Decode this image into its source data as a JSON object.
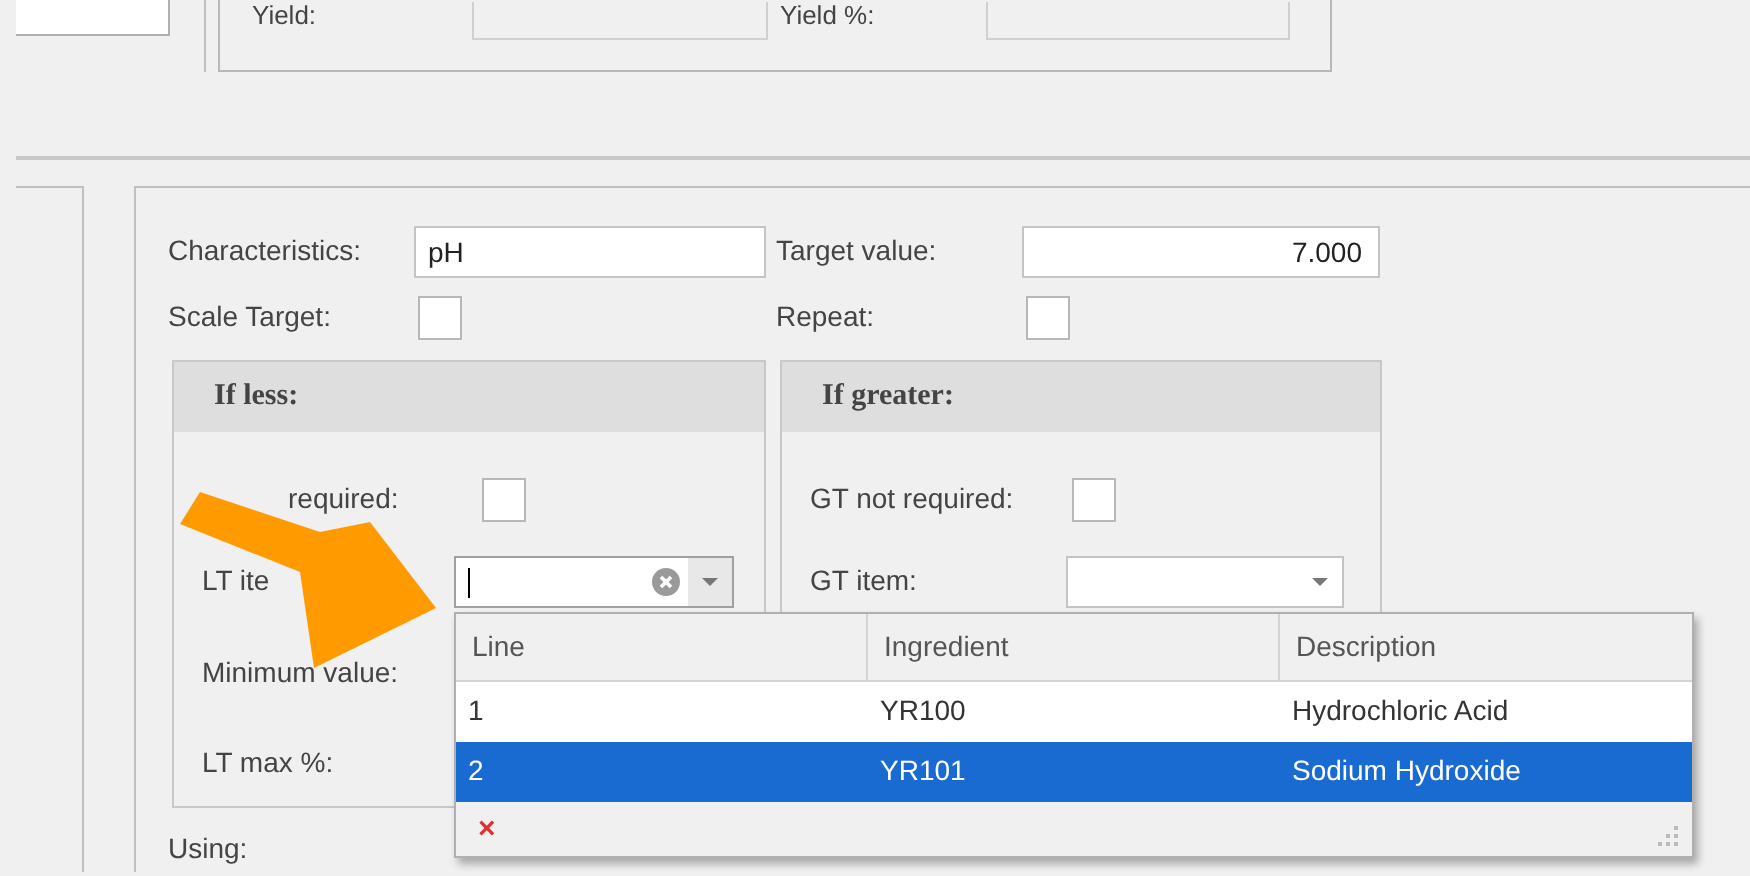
{
  "top_fields": [
    {
      "label": "Yield:"
    },
    {
      "label": "Yield %:"
    }
  ],
  "characteristics": {
    "label": "Characteristics:",
    "value": "pH"
  },
  "target_value": {
    "label": "Target value:",
    "value": "7.000"
  },
  "scale_target": {
    "label": "Scale Target:",
    "checked": false
  },
  "repeat": {
    "label": "Repeat:",
    "checked": false
  },
  "groups": [
    {
      "title": "If less:",
      "rows": [
        {
          "kind": "checkbox",
          "label": "required:",
          "checked": false
        },
        {
          "kind": "combo",
          "label": "LT ite",
          "focused": true,
          "clearable": true
        },
        {
          "kind": "text",
          "label": "Minimum value:"
        },
        {
          "kind": "text",
          "label": "LT max %:"
        }
      ]
    },
    {
      "title": "If greater:",
      "rows": [
        {
          "kind": "checkbox",
          "label": "GT not required:",
          "checked": false
        },
        {
          "kind": "combo",
          "label": "GT item:",
          "focused": false,
          "clearable": false
        }
      ]
    }
  ],
  "using": {
    "label": "Using:"
  },
  "dropdown": {
    "columns": [
      "Line",
      "Ingredient",
      "Description"
    ],
    "rows": [
      {
        "cells": [
          "1",
          "YR100",
          "Hydrochloric Acid"
        ],
        "selected": false
      },
      {
        "cells": [
          "2",
          "YR101",
          "Sodium Hydroxide"
        ],
        "selected": true
      }
    ],
    "footer_icon": "×"
  }
}
